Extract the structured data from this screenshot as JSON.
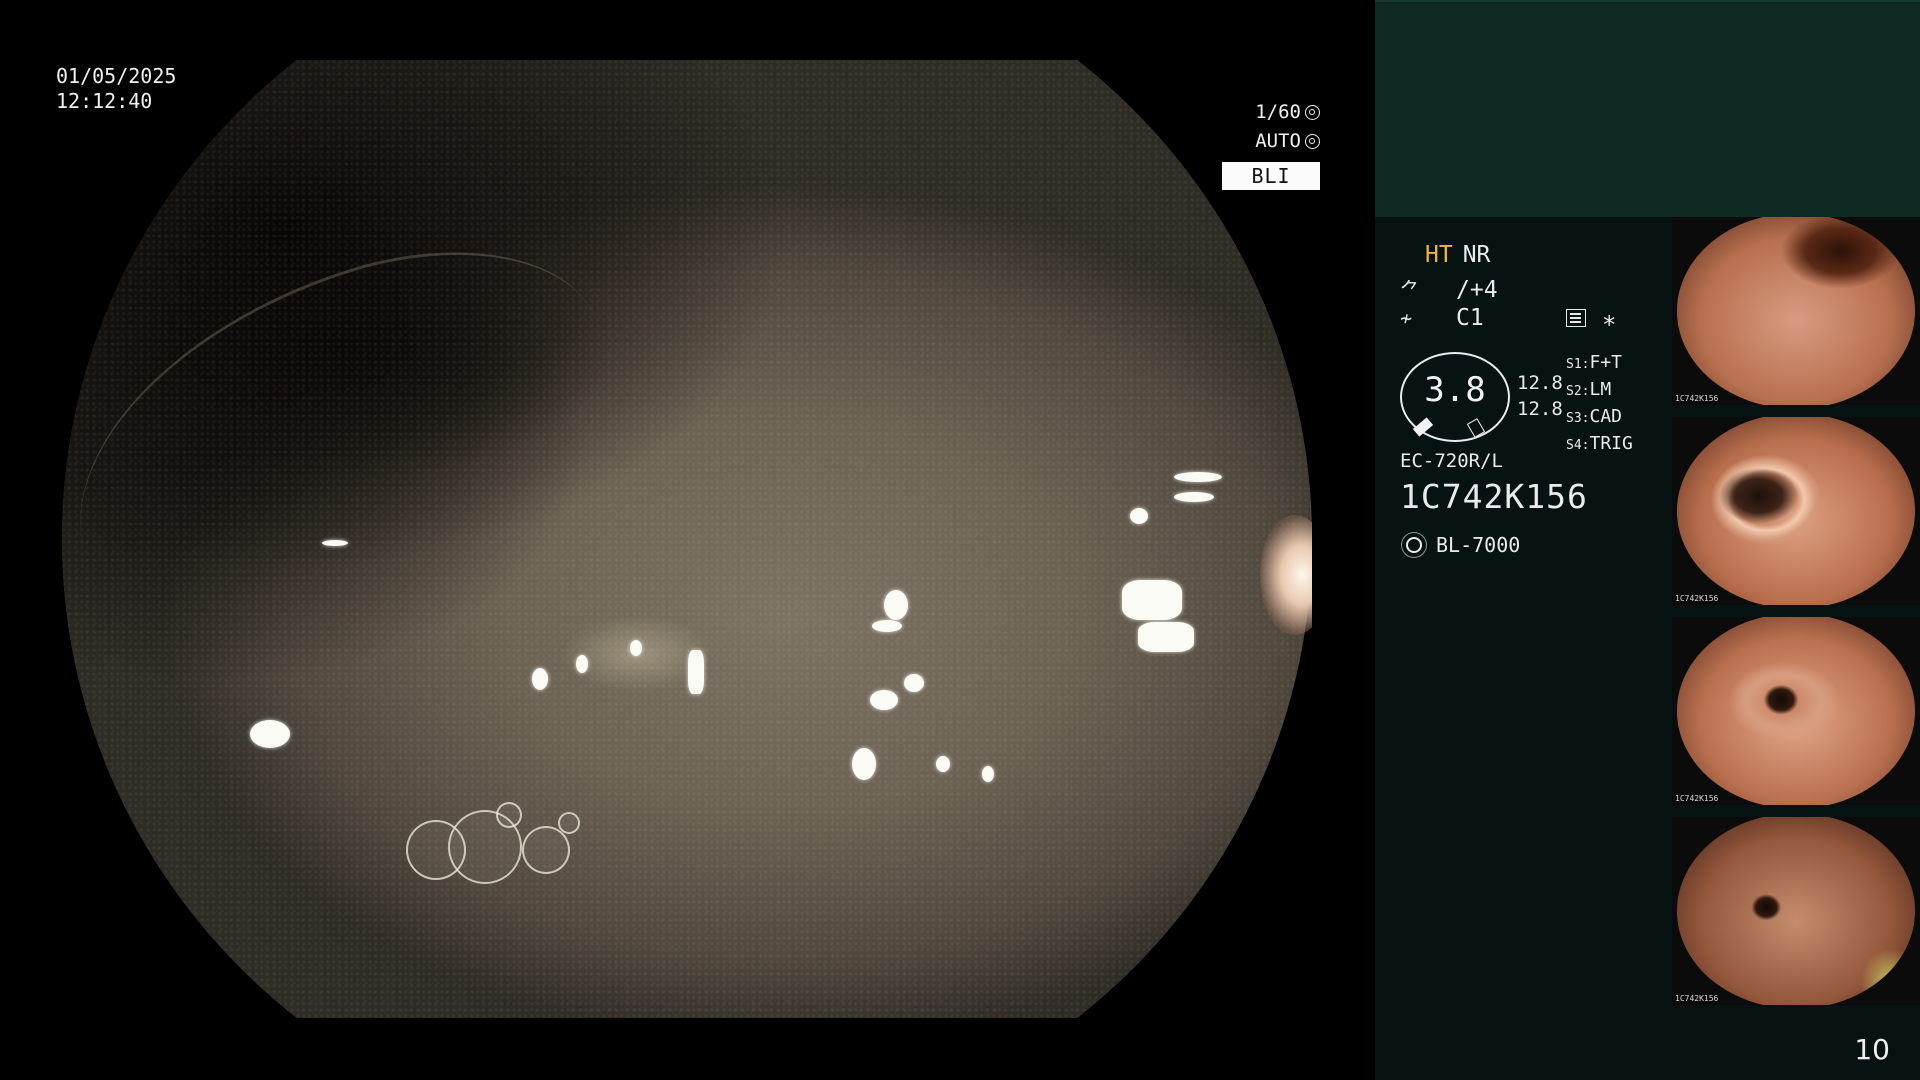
{
  "screen": {
    "date": "01/05/2025",
    "time": "12:12:40",
    "shutter": "1/60",
    "exposure": "AUTO",
    "mode": "BLI",
    "page_number": "10"
  },
  "panel": {
    "ht": "HT",
    "nr": "NR",
    "enhancement_symbol": "⺈",
    "enhancement": "/+4",
    "color_symbol": "≁",
    "color": "C1",
    "star": "∗",
    "zoom": "3.8",
    "zoom_a": "12.8",
    "zoom_b": "12.8",
    "presets": [
      {
        "key": "S1",
        "value": "F+T"
      },
      {
        "key": "S2",
        "value": "LM"
      },
      {
        "key": "S3",
        "value": "CAD"
      },
      {
        "key": "S4",
        "value": "TRIG"
      }
    ],
    "scope_model": "EC-720R/L",
    "serial": "1C742K156",
    "light_source": "BL-7000"
  },
  "thumbnails": [
    {
      "caption": "1C742K156"
    },
    {
      "caption": "1C742K156"
    },
    {
      "caption": "1C742K156"
    },
    {
      "caption": "1C742K156"
    }
  ],
  "colors": {
    "panel_dark": "#061312",
    "panel_top": "#0f2a23",
    "ht_accent": "#f2b53c",
    "text": "#e8ecea"
  },
  "icons": {
    "shutter": "aperture-icon",
    "exposure": "iris-icon",
    "settings": "settings-list-icon",
    "light": "lamp-icon"
  }
}
